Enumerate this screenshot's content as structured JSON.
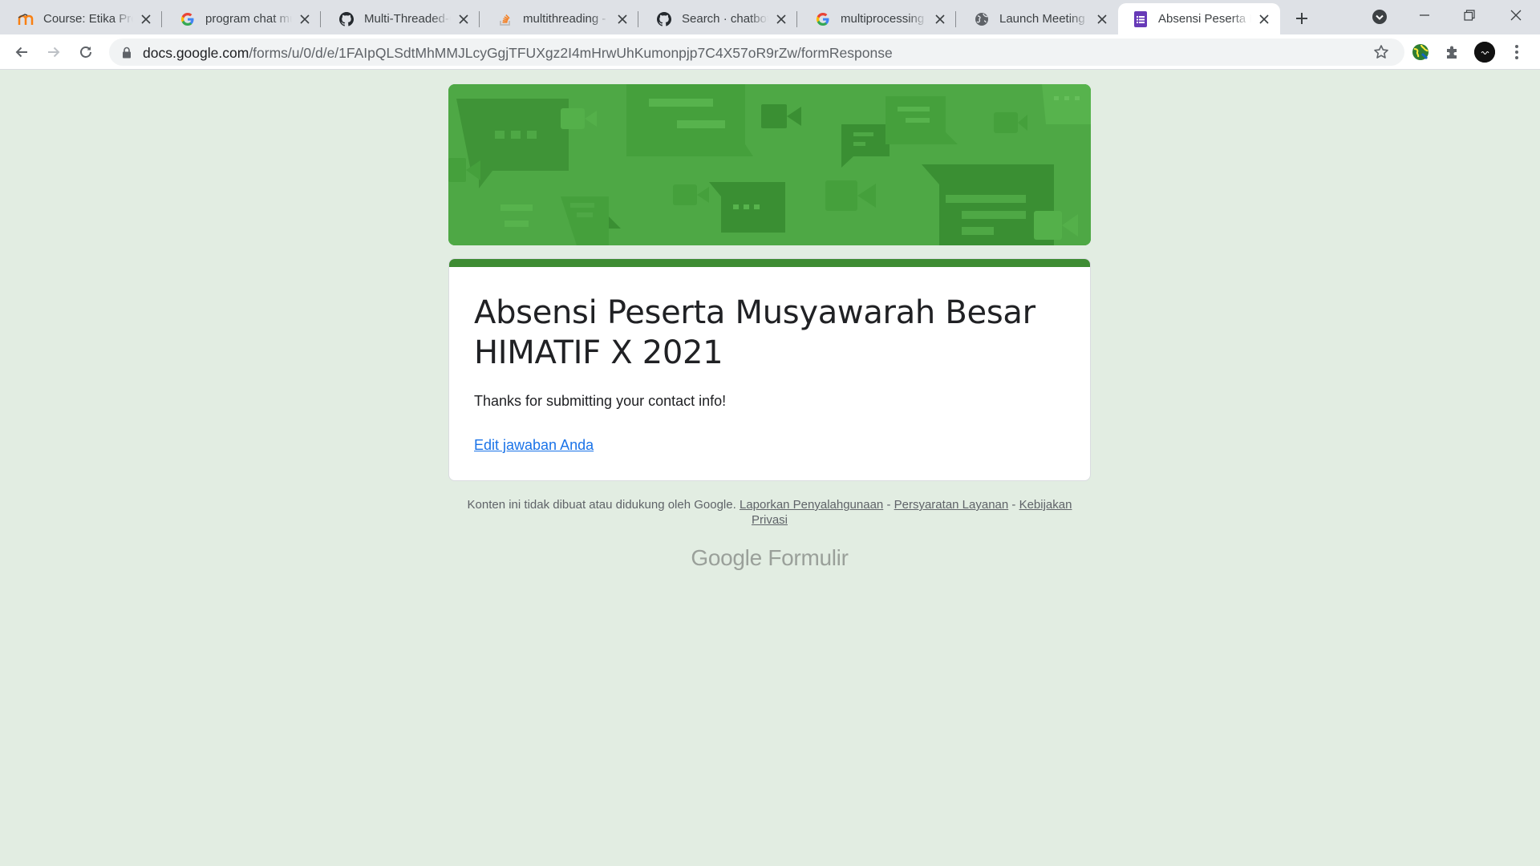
{
  "browser": {
    "tabs": [
      {
        "title": "Course: Etika Profesi",
        "icon": "moodle-icon",
        "active": false
      },
      {
        "title": "program chat multi",
        "icon": "google-icon",
        "active": false
      },
      {
        "title": "Multi-Threaded-Chat",
        "icon": "github-icon",
        "active": false
      },
      {
        "title": "multithreading - Stack",
        "icon": "stackoverflow-icon",
        "active": false
      },
      {
        "title": "Search · chatbot · GitHub",
        "icon": "github-icon",
        "active": false
      },
      {
        "title": "multiprocessing java",
        "icon": "google-icon",
        "active": false
      },
      {
        "title": "Launch Meeting - Zoom",
        "icon": "globe-icon",
        "active": false
      },
      {
        "title": "Absensi Peserta Musyawarah",
        "icon": "forms-icon",
        "active": true
      }
    ],
    "address": {
      "host": "docs.google.com",
      "path": "/forms/u/0/d/e/1FAIpQLSdtMhMMJLcyGgjTFUXgz2I4mHrwUhKumonpjp7C4X57oR9rZw/formResponse"
    },
    "colors": {
      "tab_strip": "#dee1e6",
      "toolbar": "#ffffff",
      "omnibox": "#f1f3f4"
    }
  },
  "form": {
    "title": "Absensi Peserta Musyawarah Besar HIMATIF X 2021",
    "confirmation": "Thanks for submitting your contact info!",
    "edit_link": "Edit jawaban Anda",
    "colors": {
      "page_bg": "#e2ede2",
      "theme": "#3e8c33",
      "header_bg": "#4ea845",
      "link": "#1a73e8"
    }
  },
  "footer": {
    "disclaimer": "Konten ini tidak dibuat atau didukung oleh Google.",
    "report_link": "Laporkan Penyalahgunaan",
    "sep1": "-",
    "terms_link": "Persyaratan Layanan",
    "sep2": "-",
    "privacy_link": "Kebijakan Privasi",
    "brand_google": "Google",
    "brand_product": "Formulir"
  }
}
